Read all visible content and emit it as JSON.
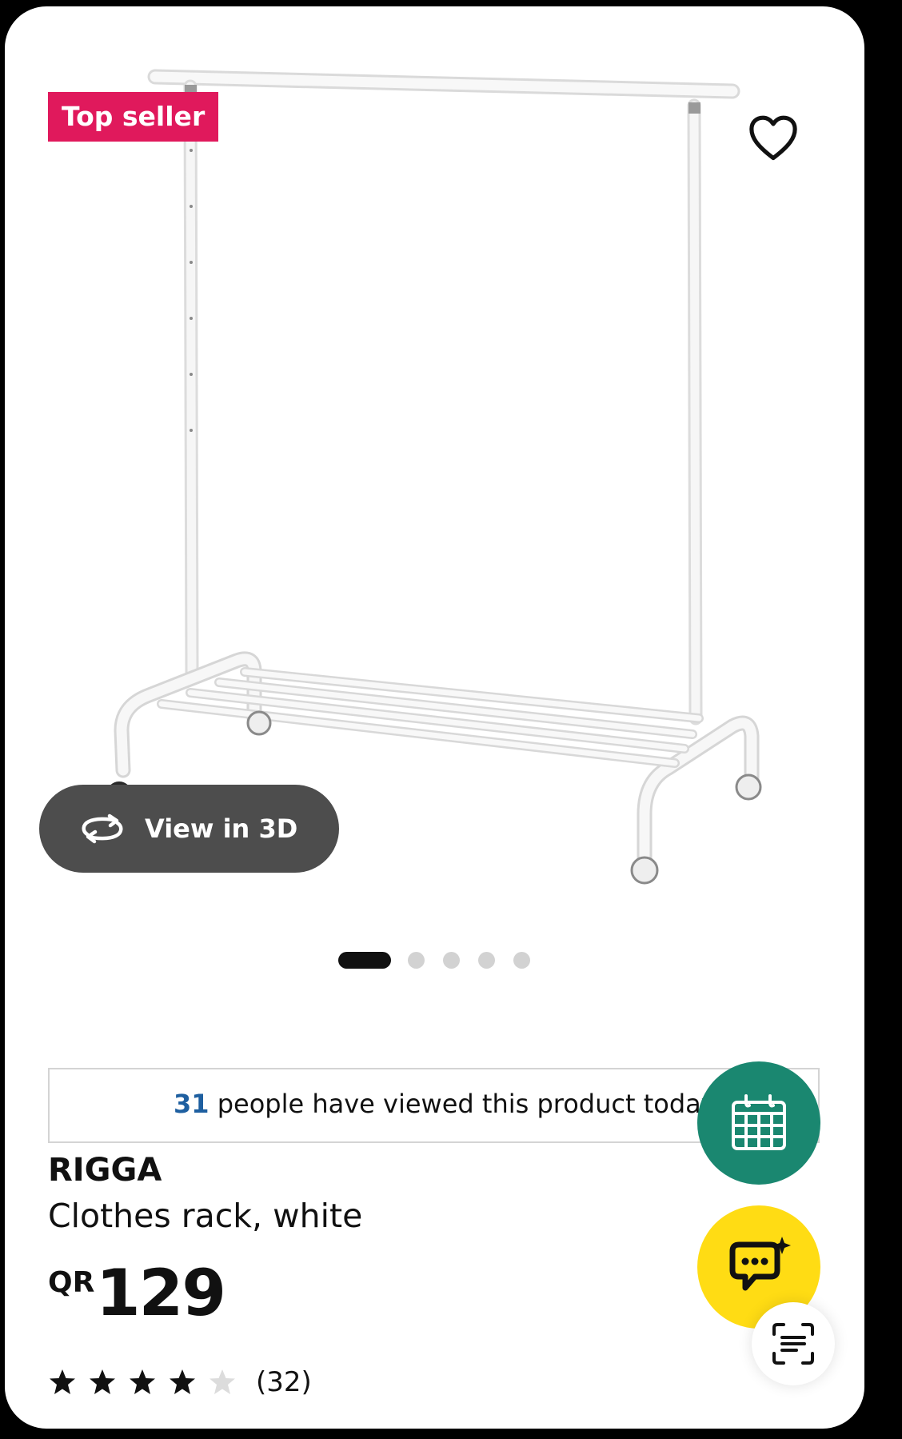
{
  "product": {
    "badge": "Top seller",
    "view_3d_label": "View in 3D",
    "gallery": {
      "image_count": 5,
      "active_index": 0
    },
    "viewers": {
      "count": "31",
      "text": " people have viewed this product today"
    },
    "brand": "RIGGA",
    "description": "Clothes rack, white",
    "price": {
      "currency": "QR",
      "amount": "129"
    },
    "rating": {
      "stars": 4,
      "max": 5,
      "reviews": "(32)"
    }
  },
  "colors": {
    "badge": "#e0195c",
    "calendar_button": "#1a8770",
    "chat_button": "#ffdc14",
    "viewer_count": "#1e5fa0"
  },
  "icons": [
    "heart-icon",
    "rotate-3d-icon",
    "calendar-icon",
    "chat-sparkle-icon",
    "scan-icon",
    "star-icon"
  ]
}
